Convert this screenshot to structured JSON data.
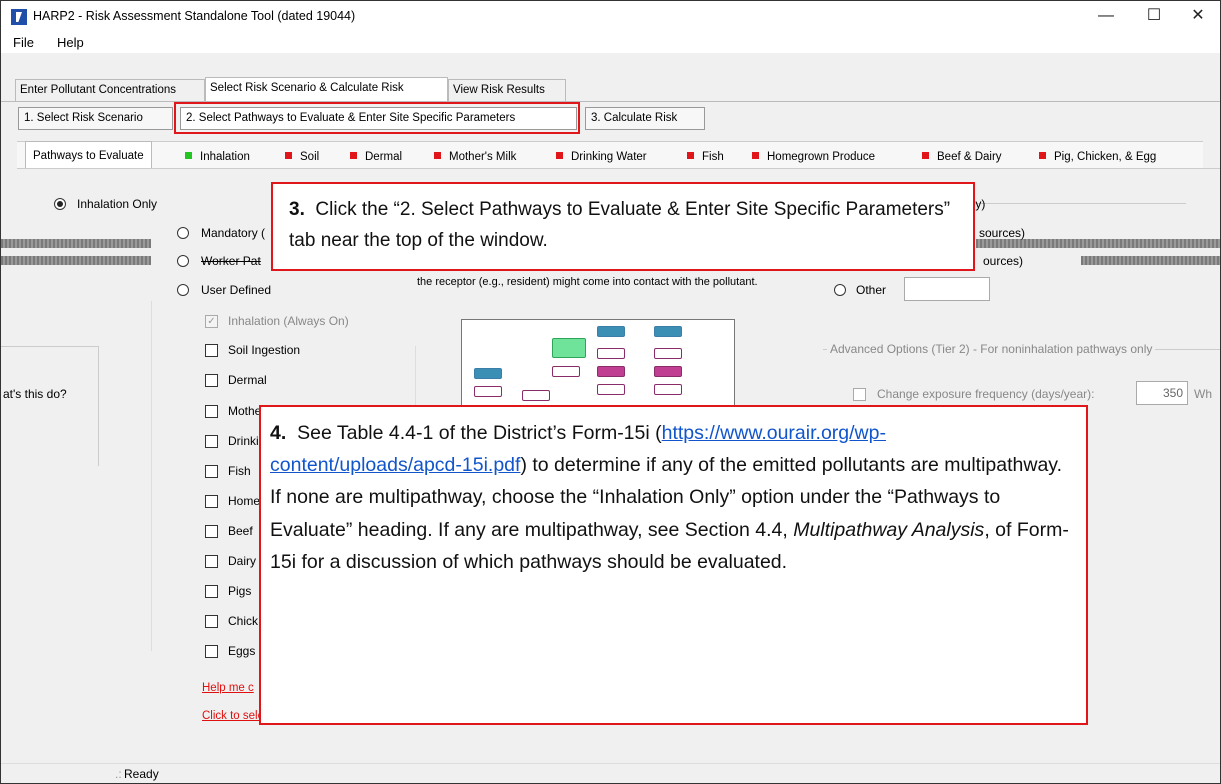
{
  "window": {
    "title": "HARP2 - Risk Assessment Standalone Tool (dated 19044)",
    "min": "—",
    "max": "☐",
    "close": "✕"
  },
  "menu": [
    "File",
    "Help"
  ],
  "main_tabs": [
    "Enter Pollutant Concentrations",
    "Select Risk Scenario & Calculate Risk",
    "View Risk Results"
  ],
  "step_tabs": [
    "1. Select Risk Scenario",
    "2. Select Pathways to Evaluate & Enter Site Specific Parameters",
    "3. Calculate Risk"
  ],
  "pathway_tabs": [
    {
      "label": "Pathways to Evaluate"
    },
    {
      "label": "Inhalation",
      "color": "#22c522"
    },
    {
      "label": "Soil",
      "color": "#e0161b"
    },
    {
      "label": "Dermal",
      "color": "#e0161b"
    },
    {
      "label": "Mother's Milk",
      "color": "#e0161b"
    },
    {
      "label": "Drinking Water",
      "color": "#e0161b"
    },
    {
      "label": "Fish",
      "color": "#e0161b"
    },
    {
      "label": "Homegrown Produce",
      "color": "#e0161b"
    },
    {
      "label": "Beef & Dairy",
      "color": "#e0161b"
    },
    {
      "label": "Pig, Chicken, & Egg",
      "color": "#e0161b"
    }
  ],
  "options": {
    "inhalation_only": "Inhalation Only",
    "mandatory": "Mandatory (",
    "worker": "Worker Pat",
    "user_defined": "User Defined",
    "other": "Other"
  },
  "checkboxes": {
    "inhalation": "Inhalation (Always On)",
    "soil": "Soil Ingestion",
    "dermal": "Dermal",
    "mother": "Mothe",
    "drinking": "Drinki",
    "fish": "Fish",
    "home": "Home",
    "beef": "Beef",
    "dairy": "Dairy",
    "pigs": "Pigs",
    "chick": "Chick",
    "eggs": "Eggs"
  },
  "left_text": "at's this do?",
  "right_fragments": {
    "nly": "nly)",
    "sources1": "l sources)",
    "sources2": "ources)"
  },
  "description": "the receptor (e.g., resident) might come into contact with the pollutant.",
  "advanced": {
    "heading": "Advanced Options (Tier 2) - For noninhalation pathways only",
    "freq_label": "Change exposure frequency (days/year):",
    "freq_value": "350",
    "wh": "Wh"
  },
  "links": {
    "help": "Help me c",
    "scaqmd": "Click to select SCAQMD mandatory minimum pathways"
  },
  "status": "Ready",
  "callout3": {
    "num": "3.",
    "text": "Click the “2. Select Pathways to Evaluate & Enter Site Specific Parameters” tab near the top of the window."
  },
  "callout4": {
    "num": "4.",
    "pre": "See Table 4.4-1 of the District’s Form-15i (",
    "url": "https://www.ourair.org/wp-content/uploads/apcd-15i.pdf",
    "mid": ") to determine if any of the emitted pollutants are multipathway.  If none are multipathway, choose the “Inhalation Only” option under the “Pathways to Evaluate” heading.  If any are multipathway, see Section 4.4, ",
    "italic": "Multipathway Analysis",
    "post": ", of Form-15i for a discussion of which pathways should be evaluated."
  }
}
